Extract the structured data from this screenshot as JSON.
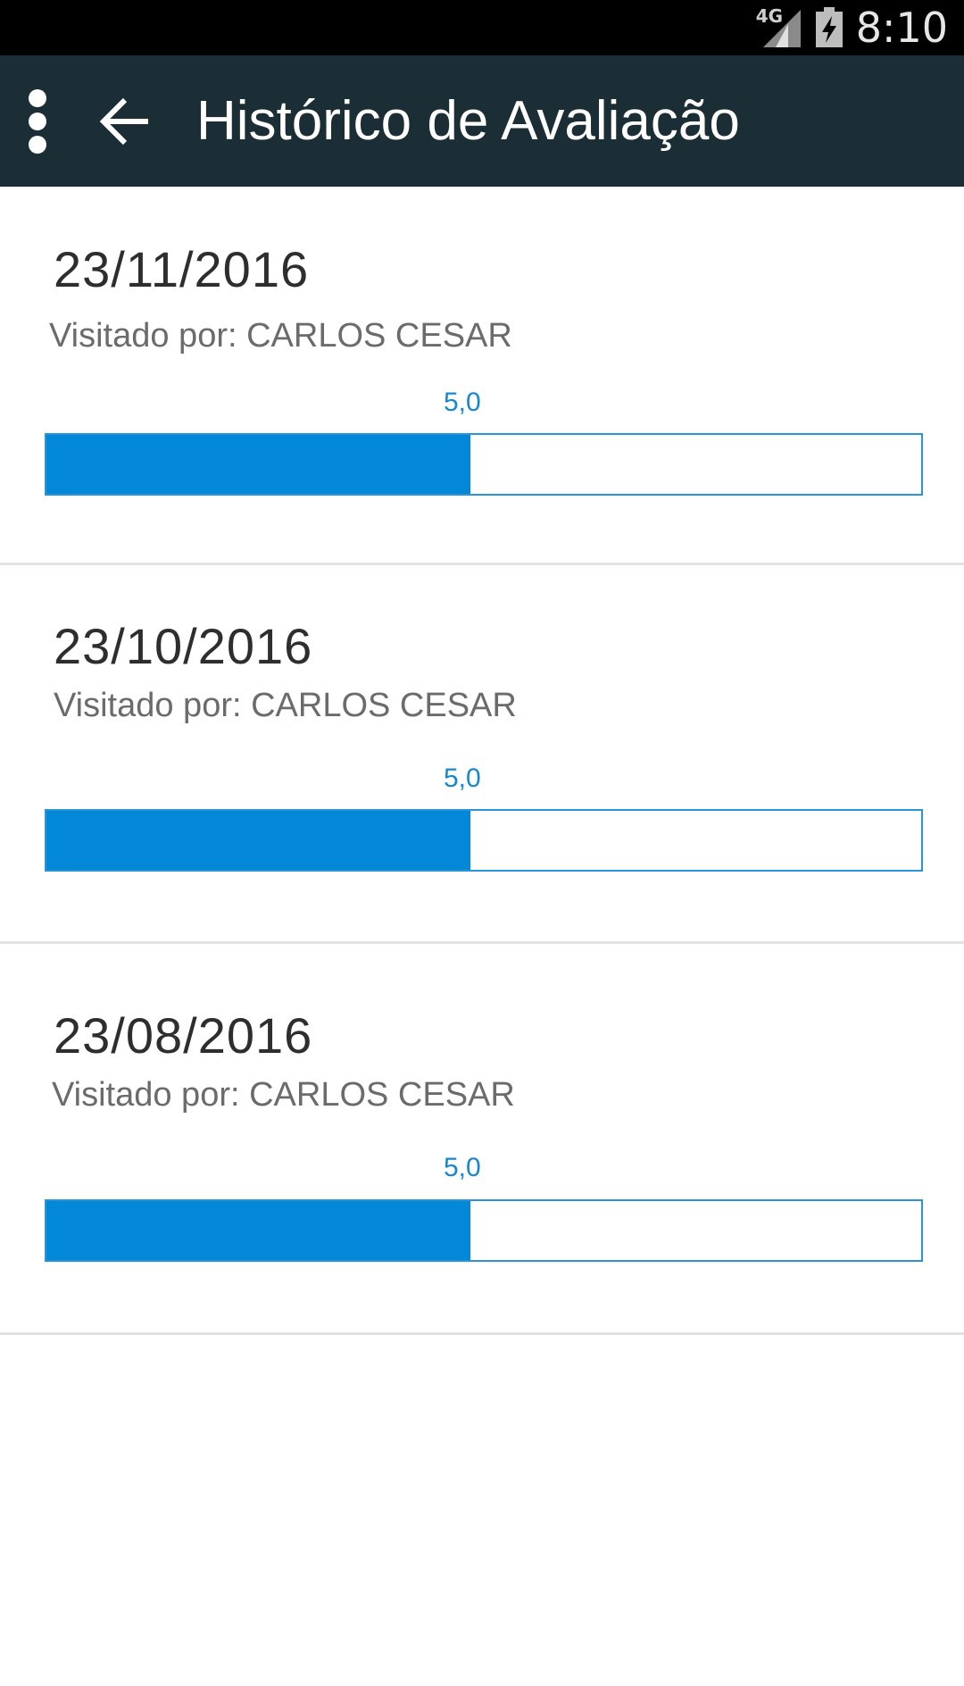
{
  "status_bar": {
    "network": "4G",
    "time": "8:10",
    "icons": [
      "signal-icon",
      "battery-charging-icon"
    ]
  },
  "app_bar": {
    "title": "Histórico de Avaliação",
    "icons": [
      "overflow-menu-icon",
      "back-arrow-icon"
    ]
  },
  "evaluations": [
    {
      "date": "23/11/2016",
      "visited_by": "Visitado por: CARLOS CESAR",
      "score": "5,0",
      "fraction": 0.485
    },
    {
      "date": "23/10/2016",
      "visited_by": "Visitado por: CARLOS CESAR",
      "score": "5,0",
      "fraction": 0.485
    },
    {
      "date": "23/08/2016",
      "visited_by": "Visitado por: CARLOS CESAR",
      "score": "5,0",
      "fraction": 0.485
    }
  ],
  "colors": {
    "app_bar": "#1b2d35",
    "progress_fill": "#0288d6",
    "progress_border": "#2a94d6",
    "score_text": "#1588cf"
  }
}
